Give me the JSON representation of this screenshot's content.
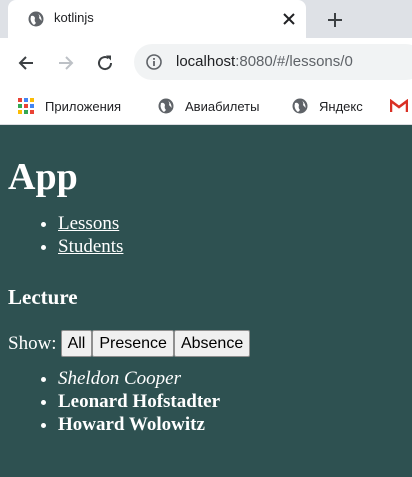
{
  "browser": {
    "tab_title": "kotlinjs",
    "url_host": "localhost",
    "url_rest": ":8080/#/lessons/0",
    "bookmarks": [
      {
        "label": "Приложения",
        "icon": "apps-grid-icon"
      },
      {
        "label": "Авиабилеты",
        "icon": "globe-icon"
      },
      {
        "label": "Яндекс",
        "icon": "globe-icon"
      }
    ]
  },
  "app": {
    "title": "App",
    "nav": [
      "Lessons",
      "Students"
    ],
    "lecture_heading": "Lecture",
    "show_label": "Show:",
    "filters": [
      "All",
      "Presence",
      "Absence"
    ],
    "students": [
      {
        "name": "Sheldon Cooper",
        "status": "present"
      },
      {
        "name": "Leonard Hofstadter",
        "status": "absent"
      },
      {
        "name": "Howard Wolowitz",
        "status": "absent"
      }
    ]
  },
  "colors": {
    "page_background": "#2e5151",
    "tabstrip": "#dee1e6",
    "omnibox": "#f1f3f4",
    "gmail_red": "#d93025"
  }
}
